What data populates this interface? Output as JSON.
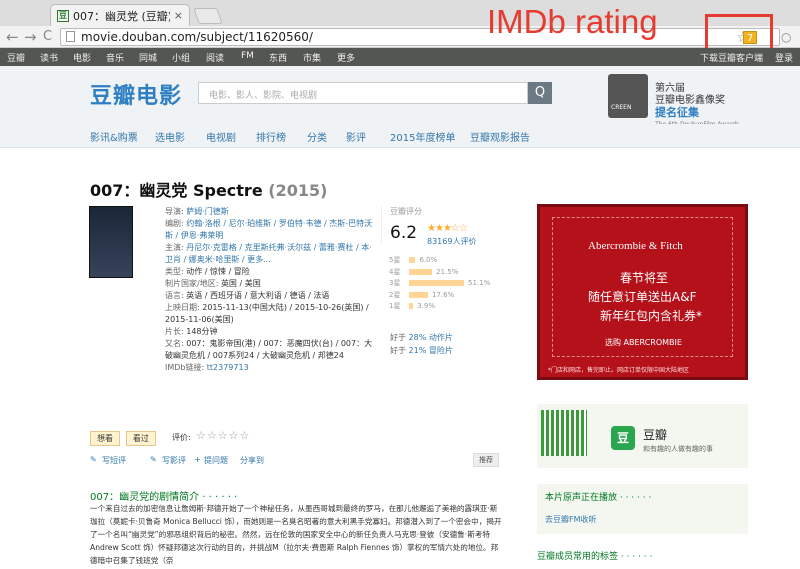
{
  "browser": {
    "tab_title": "007：幽灵党 (豆瓣)",
    "tab_close": "×",
    "favicon": "豆",
    "url": "movie.douban.com/subject/11620560/",
    "imdb_badge": "7",
    "back": "←",
    "forward": "→",
    "reload": "C",
    "star": "☆",
    "menu": "○"
  },
  "annotation": {
    "label": "IMDb rating",
    "color": "#e53b30"
  },
  "topnav": {
    "items": [
      "豆瓣",
      "读书",
      "电影",
      "音乐",
      "同城",
      "小组",
      "阅读",
      "FM",
      "东西",
      "市集",
      "更多"
    ],
    "right": [
      "下载豆瓣客户端",
      "登录"
    ]
  },
  "header": {
    "logo": "豆瓣电影",
    "search_placeholder": "电影、影人、影院、电视剧",
    "search_button": "Q",
    "award_line1": "第六届",
    "award_line2": "豆瓣电影鑫像奖",
    "award_line3": "提名征集",
    "award_line4": "The 6th DoubanFilm Awards",
    "award_icon_label": "CREEN"
  },
  "subnav": [
    "影讯&购票",
    "选电影",
    "电视剧",
    "排行榜",
    "分类",
    "影评",
    "2015年度榜单",
    "豆瓣观影报告"
  ],
  "movie": {
    "title": "007：幽灵党 Spectre",
    "year": "(2015)",
    "info": [
      {
        "label": "导演:",
        "value": "萨姆·门德斯"
      },
      {
        "label": "编剧:",
        "value": "约翰·洛根 / 尼尔·珀维斯 / 罗伯特·韦德 / 杰斯-巴特沃斯 / 伊恩·弗莱明"
      },
      {
        "label": "主演:",
        "value": "丹尼尔·克雷格 / 克里斯托弗·沃尔兹 / 蕾雅·赛杜 / 本·卫肖 / 娜奥米·哈里斯 / 更多..."
      },
      {
        "label": "类型:",
        "value": "动作 / 惊悚 / 冒险"
      },
      {
        "label": "制片国家/地区:",
        "value": "英国 / 美国"
      },
      {
        "label": "语言:",
        "value": "英语 / 西班牙语 / 意大利语 / 德语 / 法语"
      },
      {
        "label": "上映日期:",
        "value": "2015-11-13(中国大陆) / 2015-10-26(英国) / 2015-11-06(美国)"
      },
      {
        "label": "片长:",
        "value": "148分钟"
      },
      {
        "label": "又名:",
        "value": "007：鬼影帝国(港) / 007：恶魔四伏(台) / 007：大破幽灵危机 / 007系列24 / 大破幽灵危机 / 邦德24"
      },
      {
        "label": "IMDb链接:",
        "value": "tt2379713"
      }
    ]
  },
  "rating": {
    "label": "豆瓣评分",
    "score": "6.2",
    "stars": "★★★☆☆",
    "votes": "83169人评价",
    "distribution": [
      {
        "label": "5星",
        "pct": "6.0%",
        "value": 6.0
      },
      {
        "label": "4星",
        "pct": "21.5%",
        "value": 21.5
      },
      {
        "label": "3星",
        "pct": "51.1%",
        "value": 51.1
      },
      {
        "label": "2星",
        "pct": "17.6%",
        "value": 17.6
      },
      {
        "label": "1星",
        "pct": "3.9%",
        "value": 3.9
      }
    ],
    "better": [
      {
        "prefix": "好于",
        "pct": "28%",
        "genre": "动作片"
      },
      {
        "prefix": "好于",
        "pct": "21%",
        "genre": "冒险片"
      }
    ]
  },
  "ad": {
    "brand": "Abercrombie & Fitch",
    "line1": "春节将至",
    "line2": "随任意订单送出A&F",
    "line3": "新年红包内含礼券*",
    "cta": "选购 ABERCROMBIE",
    "footnote": "*门店和网店，售完即止。网店订单仅限中国大陆地区"
  },
  "actions": {
    "want": "想看",
    "seen": "看过",
    "rate_label": "评价:",
    "rate_stars": "☆☆☆☆☆",
    "write_short": "写短评",
    "write_review": "写影评",
    "ask": "提问题",
    "share": "分享到",
    "recommend": "推荐",
    "pencil": "✎",
    "plus": "+"
  },
  "synopsis": {
    "title": "007：幽灵党的剧情简介 · · · · · ·",
    "text": "一个来自过去的加密信息让詹姆斯·邦德开始了一个神秘任务，从墨西哥城到最终的罗马，在那儿他邂逅了美艳的露琪亚·斯珈拉（莫妮卡·贝鲁奇 Monica Bellucci 饰），而她则是一名臭名昭著的意大利黑手党寡妇。邦德潜入到了一个密会中，揭开了一个名叫“幽灵党”的邪恶组织背后的秘密。然然，远在伦敦的国家安全中心的新任负责人马克思·登彼（安德鲁·斯考特 Andrew Scott 饰）怀疑邦德这次行动的目的，并挑战M（拉尔夫·费恩斯 Ralph Fiennes 饰）掌权的军情六处的地位。邦德暗中召集了钱班党（奈"
  },
  "app": {
    "name": "豆瓣",
    "slogan": "和有趣的人做有趣的事",
    "icon": "豆"
  },
  "radio": {
    "title": "本片原声正在播放 · · · · · ·",
    "link": "去豆瓣FM收听"
  },
  "tags_title": "豆瓣成员常用的标签 · · · · · ·"
}
